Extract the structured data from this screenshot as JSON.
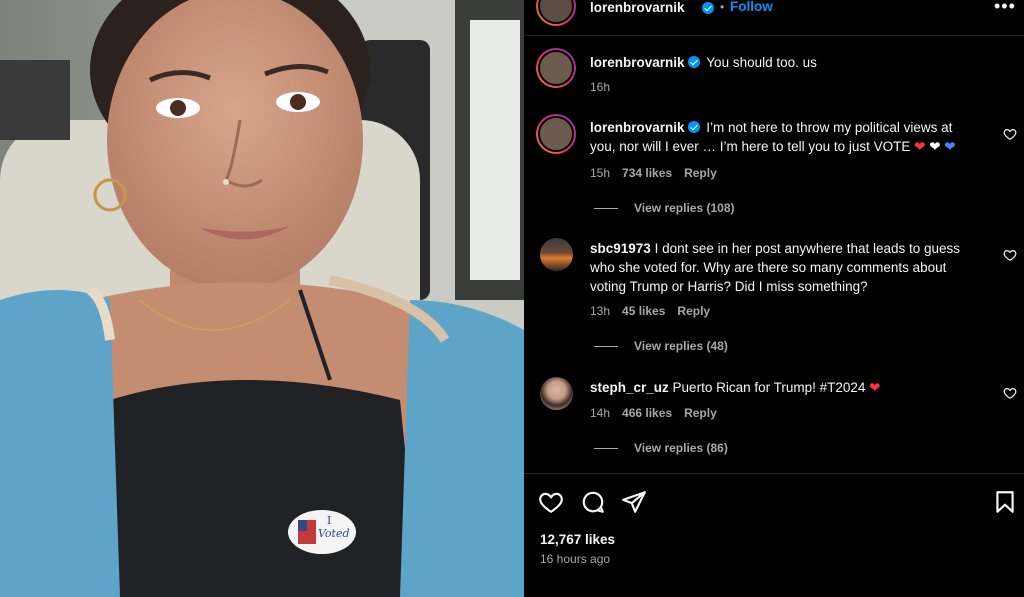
{
  "header": {
    "username": "lorenbrovarnik",
    "separator": "•",
    "follow_label": "Follow",
    "more_icon": "more-horizontal-icon"
  },
  "caption": {
    "username": "lorenbrovarnik",
    "text": "You should too. us",
    "time": "16h"
  },
  "comments": [
    {
      "username": "lorenbrovarnik",
      "verified": true,
      "line1": "I’m not here to throw my political views at",
      "line2": "you, nor will I ever … I’m here to tell you to just VOTE",
      "time": "15h",
      "likes": "734 likes",
      "reply": "Reply",
      "view_replies": "View replies (108)"
    },
    {
      "username": "sbc91973",
      "line1": "I dont see in her post anywhere that leads to guess",
      "line2": "who she voted for. Why are there so many comments about",
      "line3": "voting Trump or Harris? Did I miss something?",
      "time": "13h",
      "likes": "45 likes",
      "reply": "Reply",
      "view_replies": "View replies (48)"
    },
    {
      "username": "steph_cr_uz",
      "line1": "Puerto Rican for Trump! #T2024",
      "time": "14h",
      "likes": "466 likes",
      "reply": "Reply",
      "view_replies": "View replies (86)"
    }
  ],
  "footer": {
    "likes": "12,767 likes",
    "time": "16 hours ago"
  },
  "photo": {
    "sticker_text_1": "I",
    "sticker_text_2": "Voted"
  },
  "colors": {
    "accent": "#0095f6",
    "heart_red": "#ff3040",
    "heart_blue": "#3d8bff",
    "muted": "#a8a8a8"
  }
}
